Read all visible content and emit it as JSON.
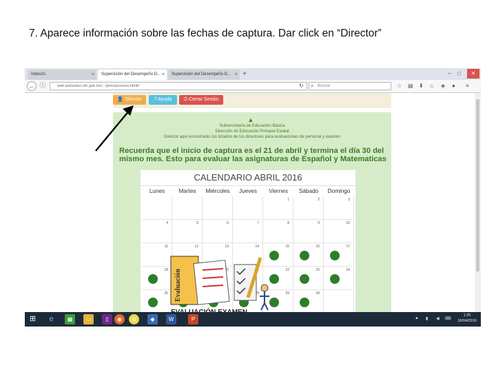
{
  "instruction": "7. Aparece información sobre las fechas de captura. Dar click en “Director”",
  "browser": {
    "tabs": [
      {
        "label": "Index2s",
        "close": "×"
      },
      {
        "label": "Supervisión del Desempeño D...",
        "close": "×"
      },
      {
        "label": "Supervisión del Desempeño D...",
        "close": "×"
      }
    ],
    "new_tab": "+",
    "window_controls": {
      "minimize": "–",
      "maximize": "□",
      "close": "✕"
    },
    "url": "web.sedueduc.sfe.gob.mx/.../percepciones.html#",
    "search_placeholder": "Buscar"
  },
  "app": {
    "buttons": {
      "director": "Director",
      "ayuda": "Ayuda",
      "cerrar": "Cerrar Sesión"
    },
    "header_lines": [
      "Subsecretaría de Educación Básica",
      "Dirección de Educación Primaria Estatal",
      "Director aquí encontrarás los listados de tus directores para evaluaciones de personal y examen"
    ],
    "notice": "Recuerda que el inicio de captura es el 21 de abril y termina el día 30 del mismo mes. Esto para evaluar las asignaturas de Español y Matematicas",
    "calendar": {
      "title": "CALENDARIO ABRIL 2016",
      "days": [
        "Lunes",
        "Martes",
        "Miércoles",
        "Jueves",
        "Viernes",
        "Sábado",
        "Domingo"
      ],
      "weeks": [
        [
          "",
          "",
          "",
          "",
          "1",
          "2",
          "3"
        ],
        [
          "4",
          "5",
          "6",
          "7",
          "8",
          "9",
          "10"
        ],
        [
          "11",
          "12",
          "13",
          "14",
          "15",
          "16",
          "17"
        ],
        [
          "18",
          "19",
          "20",
          "21",
          "22",
          "23",
          "24"
        ],
        [
          "25",
          "26",
          "27",
          "28",
          "29",
          "30",
          ""
        ]
      ],
      "marked_days": [
        "15",
        "16",
        "17",
        "18",
        "19",
        "20",
        "21",
        "22",
        "23",
        "24",
        "25",
        "26",
        "27",
        "28",
        "29",
        "30"
      ],
      "mark_color": "#2f7d2a"
    },
    "evaluation_image": {
      "folder_text": "Evaluación",
      "caption": "EVALUACIÓN EXAMEN"
    }
  },
  "taskbar": {
    "clock_time": "1:25",
    "clock_date": "18/04/2016"
  },
  "colors": {
    "director": "#f0ad4e",
    "ayuda": "#5bc0de",
    "cerrar": "#d9534f",
    "green_panel": "#d6ecc9",
    "notice_text": "#3d7a26"
  }
}
